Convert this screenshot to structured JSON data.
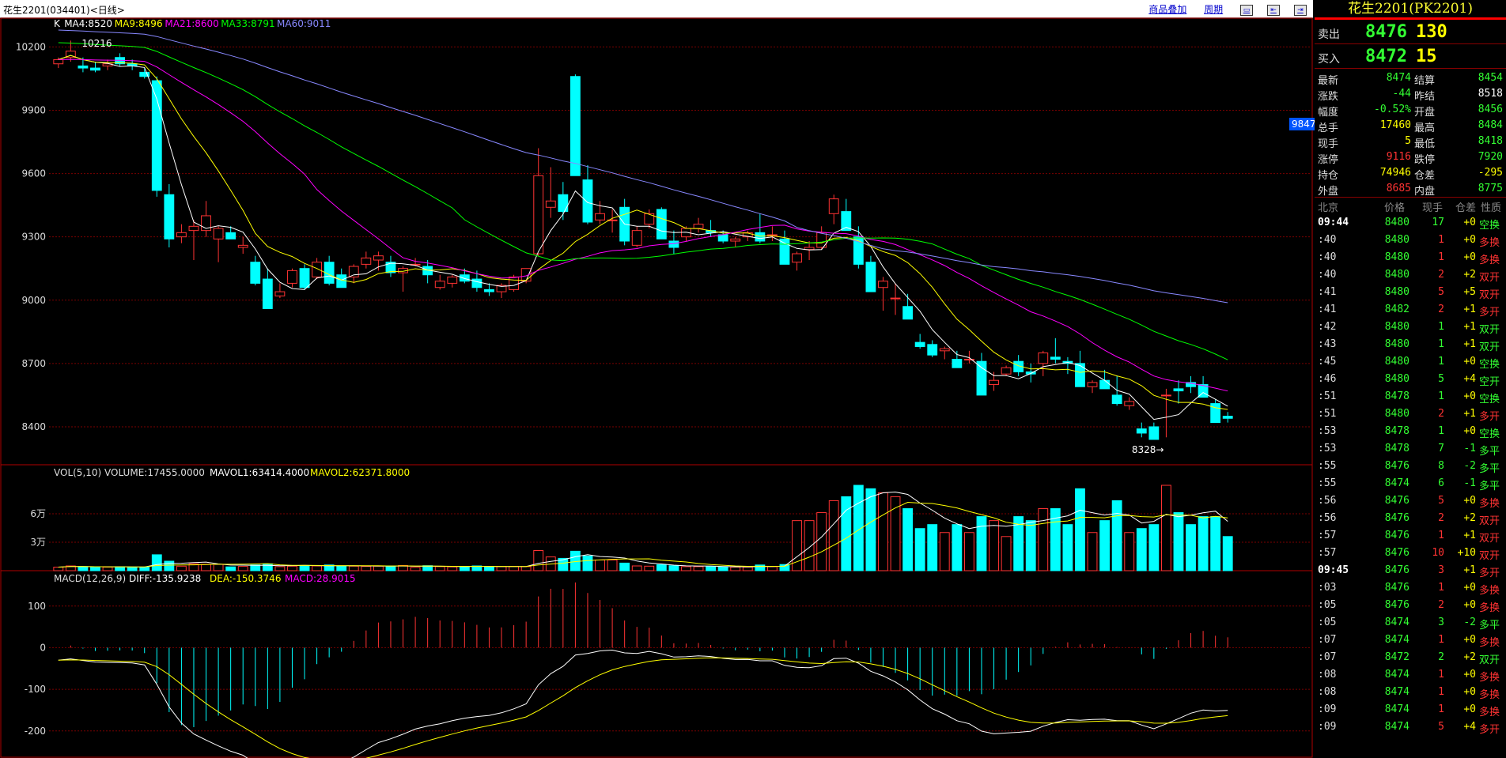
{
  "title": "花生2201(034401)<日线>",
  "toolbar": {
    "overlay": "商品叠加",
    "cycle": "周期"
  },
  "panel_title": "花生2201(PK2201)",
  "sell": {
    "label": "卖出",
    "price": "8476",
    "vol": "130"
  },
  "buy": {
    "label": "买入",
    "price": "8472",
    "vol": "15"
  },
  "stats": [
    {
      "k1": "最新",
      "v1": "8474",
      "c1": "green",
      "k2": "结算",
      "v2": "8454",
      "c2": "green"
    },
    {
      "k1": "涨跌",
      "v1": "-44",
      "c1": "green",
      "k2": "昨结",
      "v2": "8518",
      "c2": "white"
    },
    {
      "k1": "幅度",
      "v1": "-0.52%",
      "c1": "green",
      "k2": "开盘",
      "v2": "8456",
      "c2": "green"
    },
    {
      "k1": "总手",
      "v1": "17460",
      "c1": "yellow",
      "k2": "最高",
      "v2": "8484",
      "c2": "green"
    },
    {
      "k1": "现手",
      "v1": "5",
      "c1": "yellow",
      "k2": "最低",
      "v2": "8418",
      "c2": "green"
    },
    {
      "k1": "涨停",
      "v1": "9116",
      "c1": "red",
      "k2": "跌停",
      "v2": "7920",
      "c2": "green"
    },
    {
      "k1": "持仓",
      "v1": "74946",
      "c1": "yellow",
      "k2": "仓差",
      "v2": "-295",
      "c2": "yellow"
    },
    {
      "k1": "外盘",
      "v1": "8685",
      "c1": "red",
      "k2": "内盘",
      "v2": "8775",
      "c2": "green"
    }
  ],
  "tick_header": {
    "time": "北京",
    "price": "价格",
    "vol": "现手",
    "oi": "仓差",
    "type": "性质"
  },
  "ticks": [
    {
      "t": "09:44",
      "p": "8480",
      "v": "17",
      "o": "+0",
      "ty": "空换",
      "tc": "green",
      "big": true
    },
    {
      "t": ":40",
      "p": "8480",
      "v": "1",
      "o": "+0",
      "ty": "多换",
      "tc": "red"
    },
    {
      "t": ":40",
      "p": "8480",
      "v": "1",
      "o": "+0",
      "ty": "多换",
      "tc": "red"
    },
    {
      "t": ":40",
      "p": "8480",
      "v": "2",
      "o": "+2",
      "ty": "双开",
      "tc": "red"
    },
    {
      "t": ":41",
      "p": "8480",
      "v": "5",
      "o": "+5",
      "ty": "双开",
      "tc": "red"
    },
    {
      "t": ":41",
      "p": "8482",
      "v": "2",
      "o": "+1",
      "ty": "多开",
      "tc": "red"
    },
    {
      "t": ":42",
      "p": "8480",
      "v": "1",
      "o": "+1",
      "ty": "双开",
      "tc": "green"
    },
    {
      "t": ":43",
      "p": "8480",
      "v": "1",
      "o": "+1",
      "ty": "双开",
      "tc": "green"
    },
    {
      "t": ":45",
      "p": "8480",
      "v": "1",
      "o": "+0",
      "ty": "空换",
      "tc": "green"
    },
    {
      "t": ":46",
      "p": "8480",
      "v": "5",
      "o": "+4",
      "ty": "空开",
      "tc": "green"
    },
    {
      "t": ":51",
      "p": "8478",
      "v": "1",
      "o": "+0",
      "ty": "空换",
      "tc": "green"
    },
    {
      "t": ":51",
      "p": "8480",
      "v": "2",
      "o": "+1",
      "ty": "多开",
      "tc": "red"
    },
    {
      "t": ":53",
      "p": "8478",
      "v": "1",
      "o": "+0",
      "ty": "空换",
      "tc": "green"
    },
    {
      "t": ":53",
      "p": "8478",
      "v": "7",
      "o": "-1",
      "ty": "多平",
      "tc": "green"
    },
    {
      "t": ":55",
      "p": "8476",
      "v": "8",
      "o": "-2",
      "ty": "多平",
      "tc": "green"
    },
    {
      "t": ":55",
      "p": "8474",
      "v": "6",
      "o": "-1",
      "ty": "多平",
      "tc": "green"
    },
    {
      "t": ":56",
      "p": "8476",
      "v": "5",
      "o": "+0",
      "ty": "多换",
      "tc": "red"
    },
    {
      "t": ":56",
      "p": "8476",
      "v": "2",
      "o": "+2",
      "ty": "双开",
      "tc": "red"
    },
    {
      "t": ":57",
      "p": "8476",
      "v": "1",
      "o": "+1",
      "ty": "双开",
      "tc": "red"
    },
    {
      "t": ":57",
      "p": "8476",
      "v": "10",
      "o": "+10",
      "ty": "双开",
      "tc": "red"
    },
    {
      "t": "09:45",
      "p": "8476",
      "v": "3",
      "o": "+1",
      "ty": "多开",
      "tc": "red",
      "big": true
    },
    {
      "t": ":03",
      "p": "8476",
      "v": "1",
      "o": "+0",
      "ty": "多换",
      "tc": "red"
    },
    {
      "t": ":05",
      "p": "8476",
      "v": "2",
      "o": "+0",
      "ty": "多换",
      "tc": "red"
    },
    {
      "t": ":05",
      "p": "8474",
      "v": "3",
      "o": "-2",
      "ty": "多平",
      "tc": "green"
    },
    {
      "t": ":07",
      "p": "8474",
      "v": "1",
      "o": "+0",
      "ty": "多换",
      "tc": "red"
    },
    {
      "t": ":07",
      "p": "8472",
      "v": "2",
      "o": "+2",
      "ty": "双开",
      "tc": "green"
    },
    {
      "t": ":08",
      "p": "8474",
      "v": "1",
      "o": "+0",
      "ty": "多换",
      "tc": "red"
    },
    {
      "t": ":08",
      "p": "8474",
      "v": "1",
      "o": "+0",
      "ty": "多换",
      "tc": "red"
    },
    {
      "t": ":09",
      "p": "8474",
      "v": "1",
      "o": "+0",
      "ty": "多换",
      "tc": "red"
    },
    {
      "t": ":09",
      "p": "8474",
      "v": "5",
      "o": "+4",
      "ty": "多开",
      "tc": "red"
    }
  ],
  "marker_price": "9847",
  "chart_data": [
    {
      "type": "candlestick",
      "legend": [
        "K",
        "MA4:8520",
        "MA9:8496",
        "MA21:8600",
        "MA33:8791",
        "MA60:9011"
      ],
      "legend_colors": [
        "#ffffff",
        "#ffffff",
        "#ffff00",
        "#ff00ff",
        "#00ff00",
        "#8888ff"
      ],
      "ylim": [
        8220,
        10340
      ],
      "yticks": [
        10200,
        9900,
        9600,
        9300,
        9000,
        8700,
        8400
      ],
      "high_label": "10216",
      "low_label": "8328",
      "candles": [
        [
          10120,
          10150,
          10100,
          10140
        ],
        [
          10150,
          10230,
          10130,
          10180
        ],
        [
          10110,
          10150,
          10080,
          10100
        ],
        [
          10100,
          10130,
          10080,
          10090
        ],
        [
          10110,
          10140,
          10090,
          10120
        ],
        [
          10150,
          10170,
          10110,
          10120
        ],
        [
          10120,
          10140,
          10090,
          10110
        ],
        [
          10080,
          10100,
          10050,
          10060
        ],
        [
          10040,
          10060,
          9490,
          9520
        ],
        [
          9500,
          9550,
          9250,
          9290
        ],
        [
          9300,
          9360,
          9270,
          9320
        ],
        [
          9330,
          9380,
          9190,
          9350
        ],
        [
          9330,
          9470,
          9300,
          9400
        ],
        [
          9290,
          9350,
          9180,
          9340
        ],
        [
          9320,
          9350,
          9290,
          9290
        ],
        [
          9250,
          9300,
          9220,
          9260
        ],
        [
          9180,
          9210,
          9070,
          9080
        ],
        [
          9100,
          9150,
          8960,
          8960
        ],
        [
          9020,
          9080,
          9010,
          9040
        ],
        [
          9080,
          9150,
          9060,
          9140
        ],
        [
          9150,
          9170,
          9050,
          9060
        ],
        [
          9110,
          9200,
          9100,
          9180
        ],
        [
          9180,
          9210,
          9070,
          9080
        ],
        [
          9120,
          9150,
          9060,
          9060
        ],
        [
          9110,
          9170,
          9080,
          9160
        ],
        [
          9170,
          9230,
          9150,
          9200
        ],
        [
          9190,
          9230,
          9140,
          9210
        ],
        [
          9180,
          9210,
          9110,
          9130
        ],
        [
          9130,
          9160,
          9040,
          9150
        ],
        [
          9170,
          9200,
          9160,
          9170
        ],
        [
          9160,
          9190,
          9080,
          9120
        ],
        [
          9060,
          9120,
          9050,
          9090
        ],
        [
          9080,
          9120,
          9060,
          9110
        ],
        [
          9120,
          9150,
          9080,
          9090
        ],
        [
          9100,
          9140,
          9040,
          9060
        ],
        [
          9050,
          9080,
          9020,
          9040
        ],
        [
          9040,
          9080,
          9010,
          9070
        ],
        [
          9050,
          9120,
          9040,
          9110
        ],
        [
          9090,
          9150,
          9080,
          9150
        ],
        [
          9220,
          9720,
          9210,
          9590
        ],
        [
          9440,
          9630,
          9390,
          9470
        ],
        [
          9500,
          9560,
          9380,
          9420
        ],
        [
          10060,
          10070,
          9590,
          9590
        ],
        [
          9570,
          9640,
          9360,
          9370
        ],
        [
          9380,
          9470,
          9360,
          9410
        ],
        [
          9380,
          9430,
          9320,
          9380
        ],
        [
          9440,
          9480,
          9260,
          9280
        ],
        [
          9260,
          9350,
          9250,
          9330
        ],
        [
          9360,
          9430,
          9340,
          9410
        ],
        [
          9430,
          9440,
          9290,
          9290
        ],
        [
          9280,
          9330,
          9220,
          9250
        ],
        [
          9300,
          9350,
          9280,
          9340
        ],
        [
          9340,
          9390,
          9320,
          9360
        ],
        [
          9330,
          9380,
          9300,
          9320
        ],
        [
          9310,
          9330,
          9270,
          9280
        ],
        [
          9280,
          9300,
          9250,
          9290
        ],
        [
          9300,
          9330,
          9280,
          9320
        ],
        [
          9320,
          9410,
          9270,
          9280
        ],
        [
          9310,
          9350,
          9280,
          9310
        ],
        [
          9290,
          9330,
          9170,
          9170
        ],
        [
          9180,
          9230,
          9140,
          9220
        ],
        [
          9240,
          9280,
          9190,
          9250
        ],
        [
          9250,
          9350,
          9240,
          9320
        ],
        [
          9410,
          9500,
          9360,
          9480
        ],
        [
          9420,
          9480,
          9330,
          9330
        ],
        [
          9300,
          9350,
          9150,
          9170
        ],
        [
          9180,
          9210,
          9040,
          9040
        ],
        [
          9060,
          9110,
          8950,
          9090
        ],
        [
          9010,
          9080,
          8930,
          9010
        ],
        [
          8970,
          9030,
          8910,
          8910
        ],
        [
          8800,
          8840,
          8770,
          8780
        ],
        [
          8790,
          8810,
          8730,
          8740
        ],
        [
          8760,
          8780,
          8720,
          8770
        ],
        [
          8720,
          8760,
          8680,
          8680
        ],
        [
          8720,
          8760,
          8700,
          8720
        ],
        [
          8710,
          8750,
          8650,
          8550
        ],
        [
          8600,
          8660,
          8570,
          8620
        ],
        [
          8650,
          8690,
          8640,
          8680
        ],
        [
          8710,
          8740,
          8640,
          8660
        ],
        [
          8660,
          8700,
          8610,
          8650
        ],
        [
          8700,
          8760,
          8640,
          8750
        ],
        [
          8730,
          8820,
          8700,
          8720
        ],
        [
          8710,
          8730,
          8650,
          8700
        ],
        [
          8700,
          8760,
          8590,
          8590
        ],
        [
          8590,
          8620,
          8560,
          8610
        ],
        [
          8620,
          8670,
          8580,
          8580
        ],
        [
          8550,
          8640,
          8500,
          8510
        ],
        [
          8500,
          8540,
          8480,
          8520
        ],
        [
          8390,
          8420,
          8350,
          8370
        ],
        [
          8400,
          8420,
          8340,
          8340
        ],
        [
          8550,
          8580,
          8350,
          8550
        ],
        [
          8580,
          8620,
          8510,
          8570
        ],
        [
          8610,
          8640,
          8560,
          8590
        ],
        [
          8600,
          8640,
          8540,
          8540
        ],
        [
          8510,
          8530,
          8430,
          8420
        ],
        [
          8450,
          8470,
          8420,
          8440
        ]
      ]
    },
    {
      "type": "bar",
      "legend": [
        "VOL(5,10) VOLUME:17455.0000",
        "MAVOL1:63414.4000",
        "MAVOL2:62371.8000"
      ],
      "legend_colors": [
        "#dddddd",
        "#ffffff",
        "#ffff00"
      ],
      "yticks": [
        "6万",
        "3万"
      ],
      "ylim": [
        0,
        95000
      ]
    },
    {
      "type": "line",
      "legend": [
        "MACD(12,26,9)",
        "DIFF:-135.9238",
        "DEA:-150.3746",
        "MACD:28.9015"
      ],
      "legend_colors": [
        "#dddddd",
        "#ffffff",
        "#ffff00",
        "#ff00ff"
      ],
      "yticks": [
        100,
        0,
        -100,
        -200
      ],
      "ylim": [
        -265,
        185
      ]
    }
  ]
}
